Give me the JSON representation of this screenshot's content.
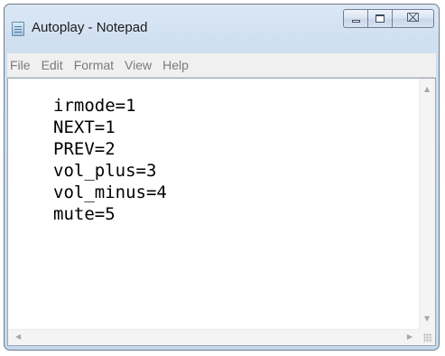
{
  "window": {
    "title": "Autoplay - Notepad",
    "caption_buttons": {
      "close_label": "⌧"
    }
  },
  "menubar": {
    "items": [
      "File",
      "Edit",
      "Format",
      "View",
      "Help"
    ]
  },
  "editor": {
    "lines": [
      "irmode=1",
      "NEXT=1",
      "PREV=2",
      "vol_plus=3",
      "vol_minus=4",
      "mute=5"
    ]
  },
  "scrollbars": {
    "up_arrow": "▲",
    "down_arrow": "▼",
    "left_arrow": "◀",
    "right_arrow": "▶"
  },
  "icons": [
    "notepad-app-icon",
    "minimize-icon",
    "maximize-icon",
    "close-icon",
    "size-grip-icon"
  ],
  "colors": {
    "title_text": "#1b1b1b",
    "menu_text": "#7a7a7a",
    "frame": "#cfdff0"
  }
}
